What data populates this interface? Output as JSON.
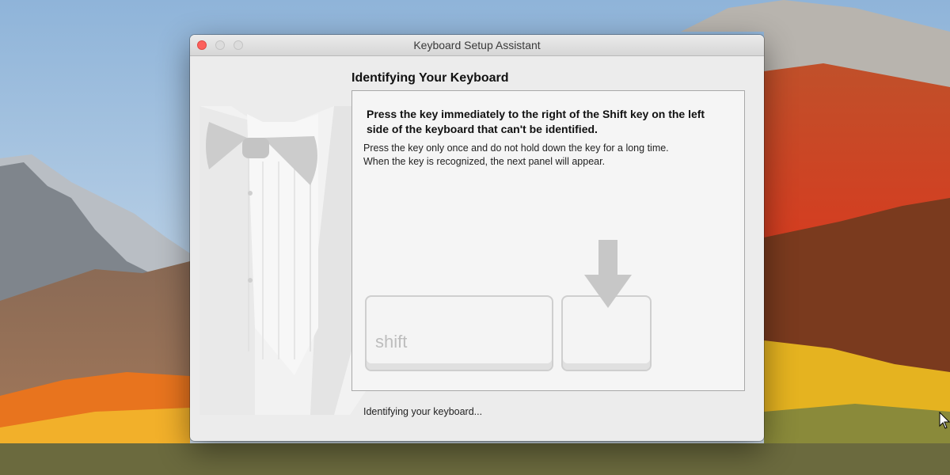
{
  "window": {
    "title": "Keyboard Setup Assistant"
  },
  "content": {
    "heading": "Identifying Your Keyboard",
    "instruction_line1": "Press the key immediately to the right of the Shift key on the left",
    "instruction_line2": "side of the keyboard that can't be identified.",
    "detail_line1": "Press the key only once and do not hold down the key for a long time.",
    "detail_line2": "When the key is recognized, the next panel will appear.",
    "shift_key_label": "shift",
    "status": "Identifying your keyboard..."
  },
  "icons": {
    "window_controls": [
      "close-icon",
      "minimize-icon",
      "zoom-icon"
    ],
    "illustration": "tuxedo-icon",
    "pointer": "down-arrow-icon"
  },
  "colors": {
    "close_button": "#fc605c",
    "window_background": "#ececec",
    "panel_background": "#f5f5f5"
  }
}
